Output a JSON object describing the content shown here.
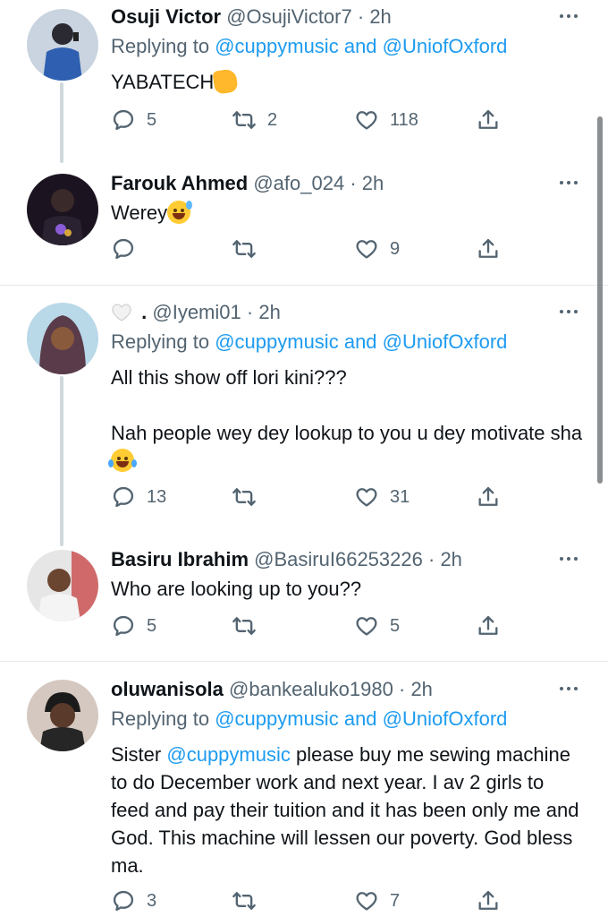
{
  "tweets": [
    {
      "name": "Osuji Victor",
      "handle": "@OsujiVictor7",
      "time": "2h",
      "replying_prefix": "Replying to",
      "replying_to_1": "@cuppymusic",
      "replying_and": "and",
      "replying_to_2": "@UniofOxford",
      "text": "YABATECH",
      "replies": "5",
      "retweets": "2",
      "likes": "118"
    },
    {
      "name": "Farouk Ahmed",
      "handle": "@afo_024",
      "time": "2h",
      "text": "Werey",
      "replies": "",
      "retweets": "",
      "likes": "9"
    },
    {
      "name": ".",
      "handle": "@Iyemi01",
      "time": "2h",
      "replying_prefix": "Replying to",
      "replying_to_1": "@cuppymusic",
      "replying_and": "and",
      "replying_to_2": "@UniofOxford",
      "text_line1": "All this show off lori kini???",
      "text_line2": "Nah people wey dey lookup to you u dey motivate sha",
      "replies": "13",
      "retweets": "",
      "likes": "31"
    },
    {
      "name": "Basiru Ibrahim",
      "handle": "@BasiruI66253226",
      "time": "2h",
      "text": "Who are looking up to you??",
      "replies": "5",
      "retweets": "",
      "likes": "5"
    },
    {
      "name": "oluwanisola",
      "handle": "@bankealuko1980",
      "time": "2h",
      "replying_prefix": "Replying to",
      "replying_to_1": "@cuppymusic",
      "replying_and": "and",
      "replying_to_2": "@UniofOxford",
      "text_prefix": "Sister",
      "text_mention": "@cuppymusic",
      "text_rest": "please buy me sewing machine to do December work and next year. I av 2 girls to feed and pay their tuition and it has been only me and God. This machine will lessen our poverty. God bless ma.",
      "replies": "3",
      "retweets": "",
      "likes": "7"
    }
  ],
  "separator": "·",
  "colors": {
    "link": "#1d9bf0",
    "secondary_text": "#536471",
    "primary_text": "#0f1419",
    "divider": "#e7e9ea",
    "thread_line": "#cfd9de"
  },
  "icons": [
    "reply-icon",
    "retweet-icon",
    "like-icon",
    "share-icon",
    "more-icon"
  ]
}
